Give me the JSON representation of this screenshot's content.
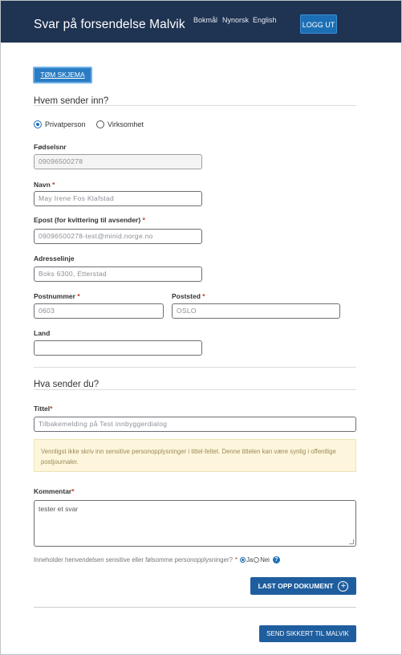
{
  "header": {
    "title": "Svar på forsendelse Malvik",
    "languages": [
      "Bokmål",
      "Nynorsk",
      "English"
    ],
    "logout_label": "LOGG UT"
  },
  "toolbar": {
    "clear_label": "TØM SKJEMA"
  },
  "sender_section": {
    "heading": "Hvem sender inn?",
    "sender_type_options": [
      {
        "label": "Privatperson",
        "selected": true
      },
      {
        "label": "Virksomhet",
        "selected": false
      }
    ],
    "fields": {
      "fodselsnr": {
        "label": "Fødselsnr",
        "required": "",
        "value": "09096500278"
      },
      "navn": {
        "label": "Navn",
        "required": "*",
        "value": "May Irene Fos Klafstad"
      },
      "epost": {
        "label": "Epost (for kvittering til avsender)",
        "required": "*",
        "value": "09096500278-test@minid.norge.no"
      },
      "adresselinje": {
        "label": "Adresselinje",
        "required": "",
        "value": "Boks 6300, Etterstad"
      },
      "postnummer": {
        "label": "Postnummer",
        "required": "*",
        "value": "0603"
      },
      "poststed": {
        "label": "Poststed",
        "required": "*",
        "value": "OSLO"
      },
      "land": {
        "label": "Land",
        "required": "",
        "value": ""
      }
    }
  },
  "content_section": {
    "heading": "Hva sender du?",
    "tittel": {
      "label": "Tittel",
      "required": "*",
      "value": "Tilbakemelding på Test innbyggerdialog"
    },
    "info_text": "Vennligst ikke skriv inn sensitive personopplysninger i tittel-feltet. Denne tittelen kan være synlig i offentlige postjournaler.",
    "kommentar": {
      "label": "Kommentar",
      "required": "*",
      "value": "tester et svar"
    },
    "sensitive_question": "Inneholder henvendelsen sensitive eller følsomme personopplysninger?",
    "sensitive_required": "*",
    "sensitive_options": [
      {
        "label": "Ja",
        "selected": true
      },
      {
        "label": "Nei",
        "selected": false
      }
    ],
    "help_icon": "?",
    "upload_label": "LAST OPP DOKUMENT",
    "upload_icon": "+"
  },
  "footer": {
    "send_label": "SEND SIKKERT TIL MALVIK"
  }
}
